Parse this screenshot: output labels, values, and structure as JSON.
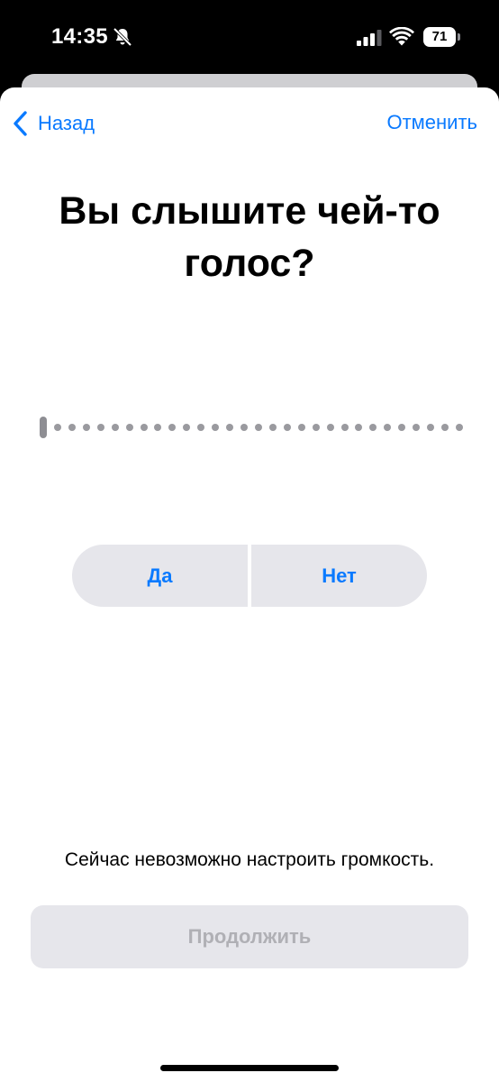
{
  "status_bar": {
    "time": "14:35",
    "battery_level": "71",
    "icons": [
      "bell-slash-icon",
      "cellular-signal-icon",
      "wifi-icon",
      "battery-icon"
    ]
  },
  "nav": {
    "back_label": "Назад",
    "cancel_label": "Отменить"
  },
  "title": "Вы слышите чей-то голос?",
  "progress": {
    "current_step": 1,
    "total_steps": 30
  },
  "answers": {
    "yes_label": "Да",
    "no_label": "Нет"
  },
  "volume_note": "Сейчас невозможно настроить громкость.",
  "continue_label": "Продолжить",
  "colors": {
    "accent": "#0a7aff",
    "button_bg": "#e6e6eb",
    "disabled_text": "#b0b0b5"
  }
}
